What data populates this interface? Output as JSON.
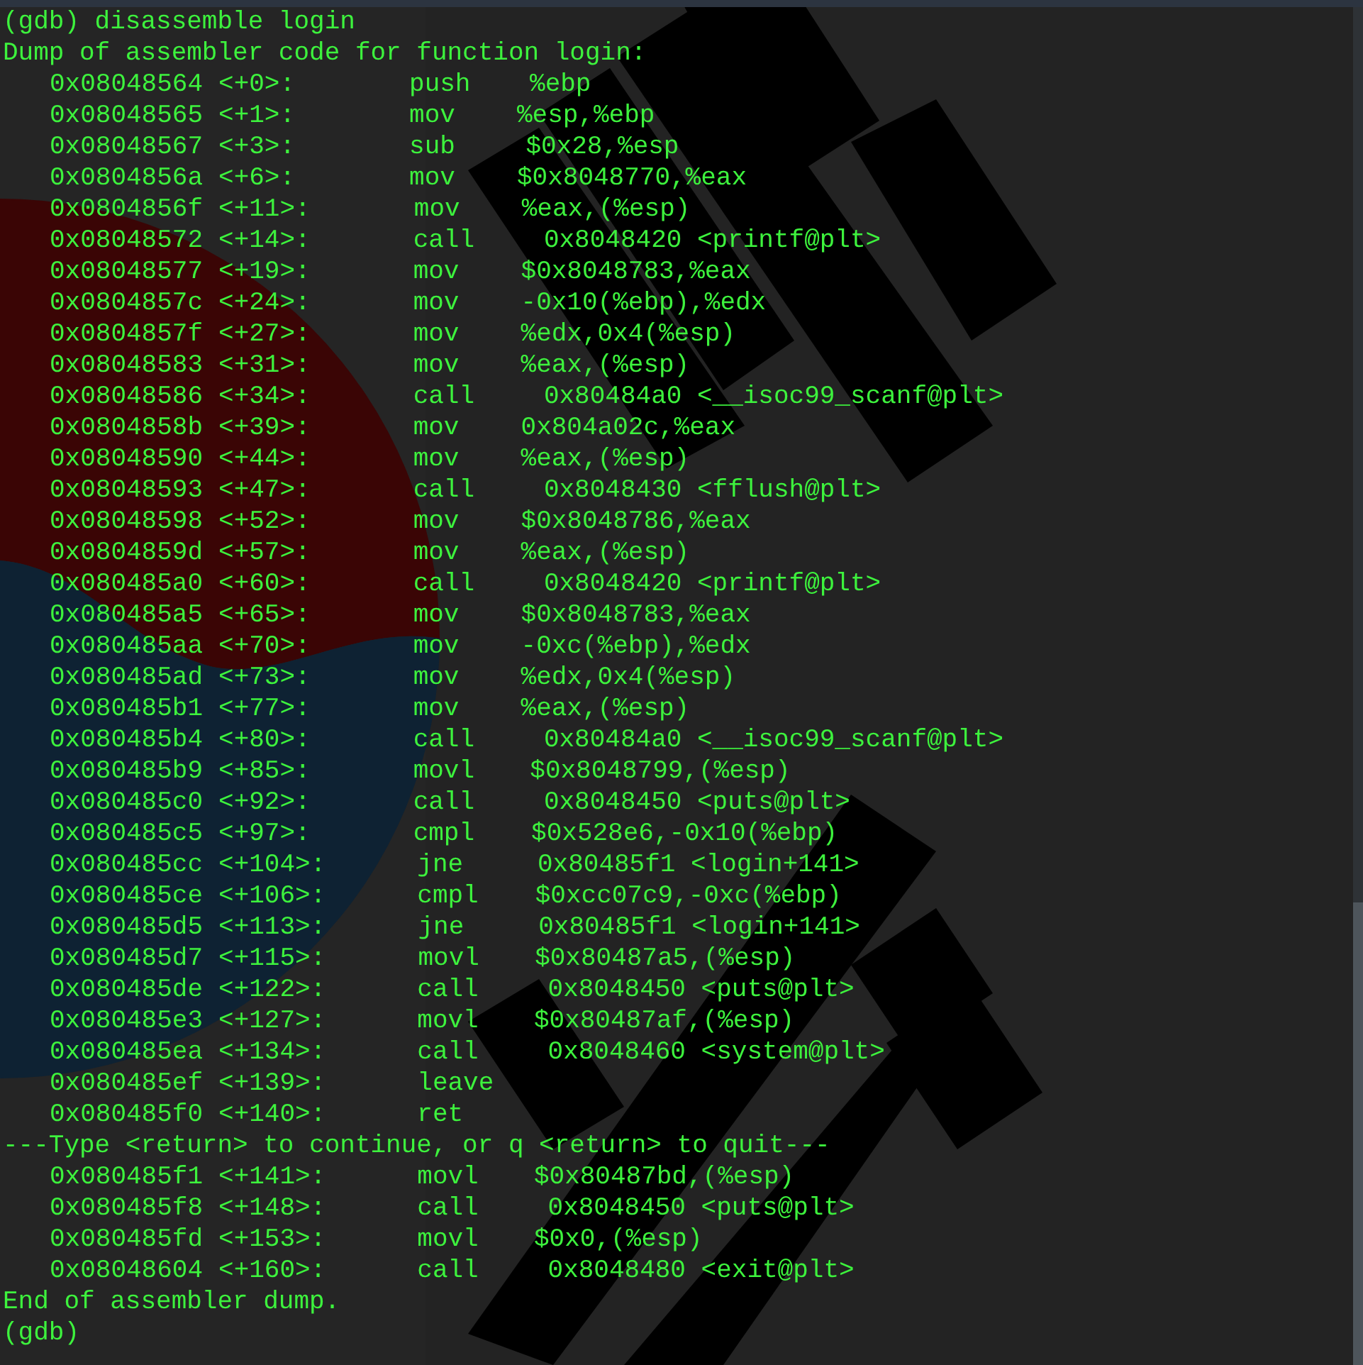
{
  "lines": [
    {
      "kind": "prompt",
      "text": "(gdb) disassemble login"
    },
    {
      "kind": "output",
      "text": "Dump of assembler code for function login:"
    },
    {
      "kind": "instruction",
      "address": "0x08048564",
      "offset": "<+0>:",
      "mnemonic": "push",
      "operands": "%ebp"
    },
    {
      "kind": "instruction",
      "address": "0x08048565",
      "offset": "<+1>:",
      "mnemonic": "mov",
      "operands": "%esp,%ebp"
    },
    {
      "kind": "instruction",
      "address": "0x08048567",
      "offset": "<+3>:",
      "mnemonic": "sub",
      "operands": "$0x28,%esp"
    },
    {
      "kind": "instruction",
      "address": "0x0804856a",
      "offset": "<+6>:",
      "mnemonic": "mov",
      "operands": "$0x8048770,%eax"
    },
    {
      "kind": "instruction",
      "address": "0x0804856f",
      "offset": "<+11>:",
      "mnemonic": "mov",
      "operands": "%eax,(%esp)"
    },
    {
      "kind": "instruction",
      "address": "0x08048572",
      "offset": "<+14>:",
      "mnemonic": "call",
      "operands": "0x8048420 <printf@plt>"
    },
    {
      "kind": "instruction",
      "address": "0x08048577",
      "offset": "<+19>:",
      "mnemonic": "mov",
      "operands": "$0x8048783,%eax"
    },
    {
      "kind": "instruction",
      "address": "0x0804857c",
      "offset": "<+24>:",
      "mnemonic": "mov",
      "operands": "-0x10(%ebp),%edx"
    },
    {
      "kind": "instruction",
      "address": "0x0804857f",
      "offset": "<+27>:",
      "mnemonic": "mov",
      "operands": "%edx,0x4(%esp)"
    },
    {
      "kind": "instruction",
      "address": "0x08048583",
      "offset": "<+31>:",
      "mnemonic": "mov",
      "operands": "%eax,(%esp)"
    },
    {
      "kind": "instruction",
      "address": "0x08048586",
      "offset": "<+34>:",
      "mnemonic": "call",
      "operands": "0x80484a0 <__isoc99_scanf@plt>"
    },
    {
      "kind": "instruction",
      "address": "0x0804858b",
      "offset": "<+39>:",
      "mnemonic": "mov",
      "operands": "0x804a02c,%eax"
    },
    {
      "kind": "instruction",
      "address": "0x08048590",
      "offset": "<+44>:",
      "mnemonic": "mov",
      "operands": "%eax,(%esp)"
    },
    {
      "kind": "instruction",
      "address": "0x08048593",
      "offset": "<+47>:",
      "mnemonic": "call",
      "operands": "0x8048430 <fflush@plt>"
    },
    {
      "kind": "instruction",
      "address": "0x08048598",
      "offset": "<+52>:",
      "mnemonic": "mov",
      "operands": "$0x8048786,%eax"
    },
    {
      "kind": "instruction",
      "address": "0x0804859d",
      "offset": "<+57>:",
      "mnemonic": "mov",
      "operands": "%eax,(%esp)"
    },
    {
      "kind": "instruction",
      "address": "0x080485a0",
      "offset": "<+60>:",
      "mnemonic": "call",
      "operands": "0x8048420 <printf@plt>"
    },
    {
      "kind": "instruction",
      "address": "0x080485a5",
      "offset": "<+65>:",
      "mnemonic": "mov",
      "operands": "$0x8048783,%eax"
    },
    {
      "kind": "instruction",
      "address": "0x080485aa",
      "offset": "<+70>:",
      "mnemonic": "mov",
      "operands": "-0xc(%ebp),%edx"
    },
    {
      "kind": "instruction",
      "address": "0x080485ad",
      "offset": "<+73>:",
      "mnemonic": "mov",
      "operands": "%edx,0x4(%esp)"
    },
    {
      "kind": "instruction",
      "address": "0x080485b1",
      "offset": "<+77>:",
      "mnemonic": "mov",
      "operands": "%eax,(%esp)"
    },
    {
      "kind": "instruction",
      "address": "0x080485b4",
      "offset": "<+80>:",
      "mnemonic": "call",
      "operands": "0x80484a0 <__isoc99_scanf@plt>"
    },
    {
      "kind": "instruction",
      "address": "0x080485b9",
      "offset": "<+85>:",
      "mnemonic": "movl",
      "operands": "$0x8048799,(%esp)"
    },
    {
      "kind": "instruction",
      "address": "0x080485c0",
      "offset": "<+92>:",
      "mnemonic": "call",
      "operands": "0x8048450 <puts@plt>"
    },
    {
      "kind": "instruction",
      "address": "0x080485c5",
      "offset": "<+97>:",
      "mnemonic": "cmpl",
      "operands": "$0x528e6,-0x10(%ebp)"
    },
    {
      "kind": "instruction",
      "address": "0x080485cc",
      "offset": "<+104>:",
      "mnemonic": "jne",
      "operands": "0x80485f1 <login+141>"
    },
    {
      "kind": "instruction",
      "address": "0x080485ce",
      "offset": "<+106>:",
      "mnemonic": "cmpl",
      "operands": "$0xcc07c9,-0xc(%ebp)"
    },
    {
      "kind": "instruction",
      "address": "0x080485d5",
      "offset": "<+113>:",
      "mnemonic": "jne",
      "operands": "0x80485f1 <login+141>"
    },
    {
      "kind": "instruction",
      "address": "0x080485d7",
      "offset": "<+115>:",
      "mnemonic": "movl",
      "operands": "$0x80487a5,(%esp)"
    },
    {
      "kind": "instruction",
      "address": "0x080485de",
      "offset": "<+122>:",
      "mnemonic": "call",
      "operands": "0x8048450 <puts@plt>"
    },
    {
      "kind": "instruction",
      "address": "0x080485e3",
      "offset": "<+127>:",
      "mnemonic": "movl",
      "operands": "$0x80487af,(%esp)"
    },
    {
      "kind": "instruction",
      "address": "0x080485ea",
      "offset": "<+134>:",
      "mnemonic": "call",
      "operands": "0x8048460 <system@plt>"
    },
    {
      "kind": "instruction",
      "address": "0x080485ef",
      "offset": "<+139>:",
      "mnemonic": "leave"
    },
    {
      "kind": "instruction",
      "address": "0x080485f0",
      "offset": "<+140>:",
      "mnemonic": "ret"
    },
    {
      "kind": "output",
      "text": "---Type <return> to continue, or q <return> to quit---"
    },
    {
      "kind": "instruction",
      "address": "0x080485f1",
      "offset": "<+141>:",
      "mnemonic": "movl",
      "operands": "$0x80487bd,(%esp)"
    },
    {
      "kind": "instruction",
      "address": "0x080485f8",
      "offset": "<+148>:",
      "mnemonic": "call",
      "operands": "0x8048450 <puts@plt>"
    },
    {
      "kind": "instruction",
      "address": "0x080485fd",
      "offset": "<+153>:",
      "mnemonic": "movl",
      "operands": "$0x0,(%esp)"
    },
    {
      "kind": "instruction",
      "address": "0x08048604",
      "offset": "<+160>:",
      "mnemonic": "call",
      "operands": "0x8048480 <exit@plt>"
    },
    {
      "kind": "output",
      "text": "End of assembler dump."
    },
    {
      "kind": "prompt",
      "text": "(gdb)"
    }
  ]
}
